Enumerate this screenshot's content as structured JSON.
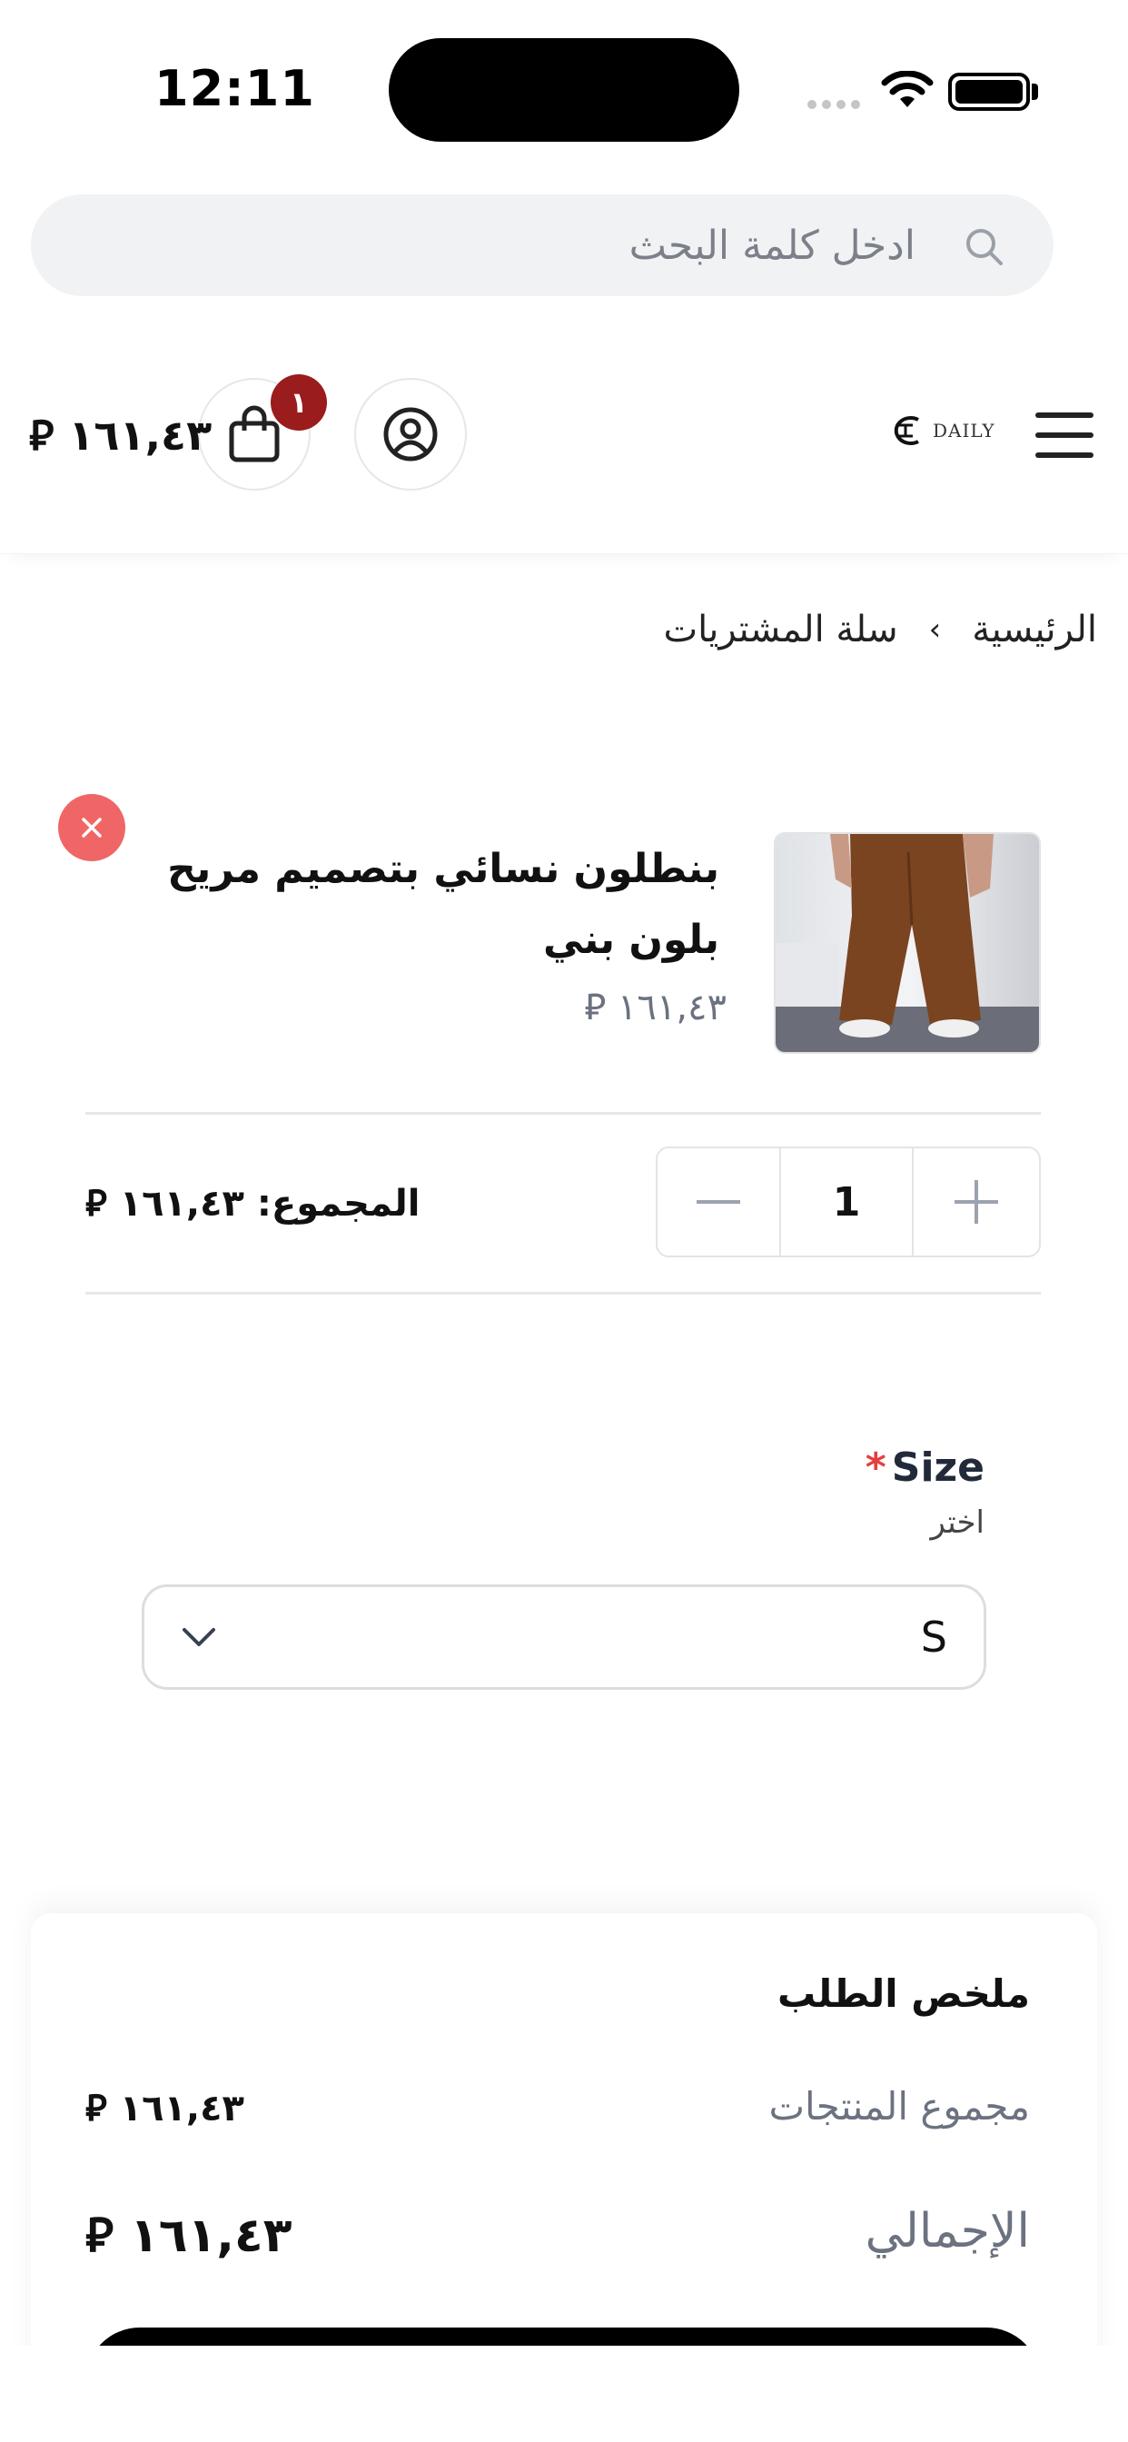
{
  "status_bar": {
    "time": "12:11"
  },
  "search": {
    "placeholder": "ادخل كلمة البحث"
  },
  "header": {
    "logo_text": "DAILY",
    "cart_count": "١",
    "cart_total": "١٦١,٤٣ ⃁"
  },
  "breadcrumb": {
    "home": "الرئيسية",
    "separator": "›",
    "current": "سلة المشتريات"
  },
  "cart_item": {
    "title": "بنطلون نسائي بتصميم مريح بلون بني",
    "price": "١٦١,٤٣ ⃁",
    "quantity": "1",
    "line_total": "المجموع: ١٦١,٤٣ ⃁"
  },
  "size_option": {
    "label": "Size",
    "required_mark": "*",
    "hint": "اختر",
    "selected": "S"
  },
  "summary": {
    "title": "ملخص الطلب",
    "subtotal_label": "مجموع المنتجات",
    "subtotal_value": "١٦١,٤٣ ⃁",
    "total_label": "الإجمالي",
    "total_value": "١٦١,٤٣ ⃁"
  },
  "colors": {
    "badge": "#9b1c1c",
    "remove": "#f06666",
    "required": "#e53e3e",
    "product_brown": "#7a4420"
  }
}
